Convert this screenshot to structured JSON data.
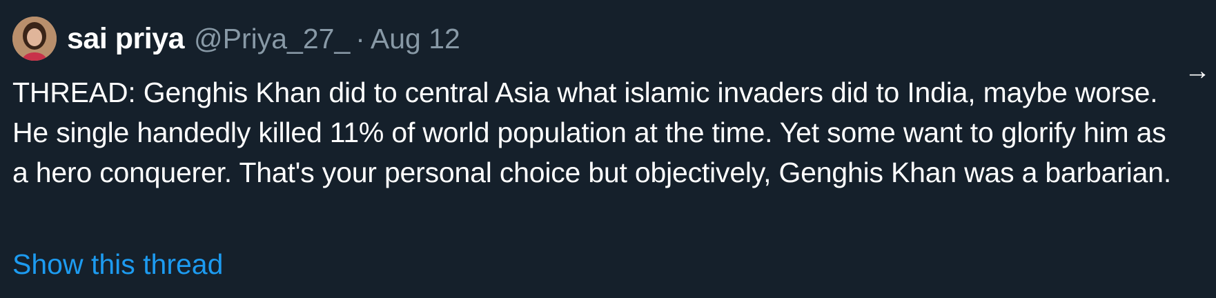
{
  "tweet": {
    "display_name": "sai priya",
    "handle": "@Priya_27_",
    "separator": "·",
    "date": "Aug 12",
    "text": "THREAD: Genghis Khan did to central Asia what islamic invaders did to India, maybe worse. He single handedly killed 11% of world population at the time. Yet some want to glorify him as a hero conquerer. That's your personal choice but objectively, Genghis Khan was a barbarian.",
    "show_thread_label": "Show this thread",
    "nav_arrow_icon": "→"
  },
  "colors": {
    "background": "#15202b",
    "primary_text": "#ffffff",
    "secondary_text": "#8899a6",
    "link": "#1d9bf0"
  },
  "icons": {
    "avatar": "avatar-photo",
    "arrow": "arrow-right-icon"
  }
}
